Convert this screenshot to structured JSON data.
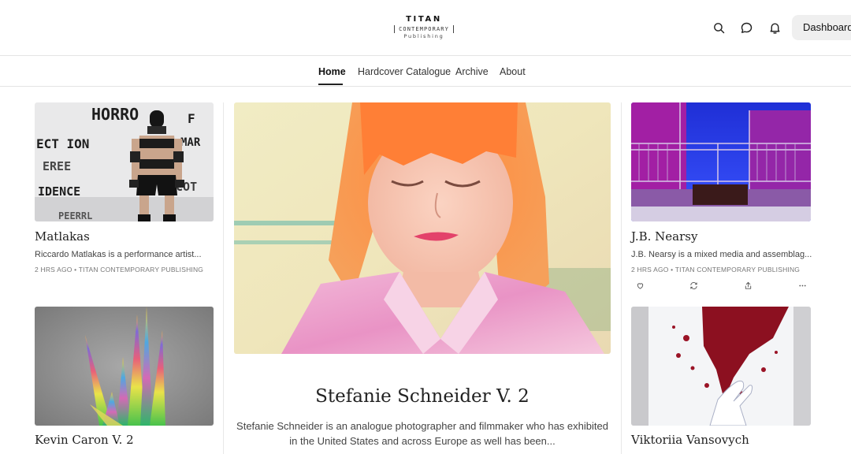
{
  "brand": {
    "line1": "TITAN",
    "line2": "CONTEMPORARY",
    "line3": "Publishing"
  },
  "header": {
    "icons": [
      "search-icon",
      "chat-icon",
      "bell-icon"
    ],
    "dashboard_label": "Dashboard"
  },
  "nav": {
    "items": [
      "Home",
      "Hardcover Catalogue",
      "Archive",
      "About"
    ],
    "active": "Home"
  },
  "posts": {
    "matlakas": {
      "title": "Matlakas",
      "desc": "Riccardo Matlakas is a performance artist...",
      "meta": "2 HRS AGO • TITAN CONTEMPORARY PUBLISHING",
      "image_text": [
        "HORRO",
        "F",
        "ECT ION",
        "MAR",
        "EREE",
        "IDENCE",
        "SCOT",
        "PEERRL"
      ]
    },
    "caron": {
      "title": "Kevin Caron V. 2"
    },
    "featured": {
      "title": "Stefanie Schneider V. 2",
      "desc": "Stefanie Schneider is an analogue photographer and filmmaker who has exhibited in the United States and across Europe as well has been..."
    },
    "nearsy": {
      "title": "J.B. Nearsy",
      "desc": "J.B. Nearsy is a mixed media and assemblag...",
      "meta": "2 HRS AGO • TITAN CONTEMPORARY PUBLISHING",
      "actions": [
        "heart-icon",
        "restack-icon",
        "share-icon",
        "more-icon"
      ]
    },
    "vansovych": {
      "title": "Viktoriia Vansovych"
    }
  },
  "colors": {
    "text": "#222222",
    "muted": "#777777",
    "divider": "#e4e4e4",
    "button_bg": "#efefef"
  }
}
